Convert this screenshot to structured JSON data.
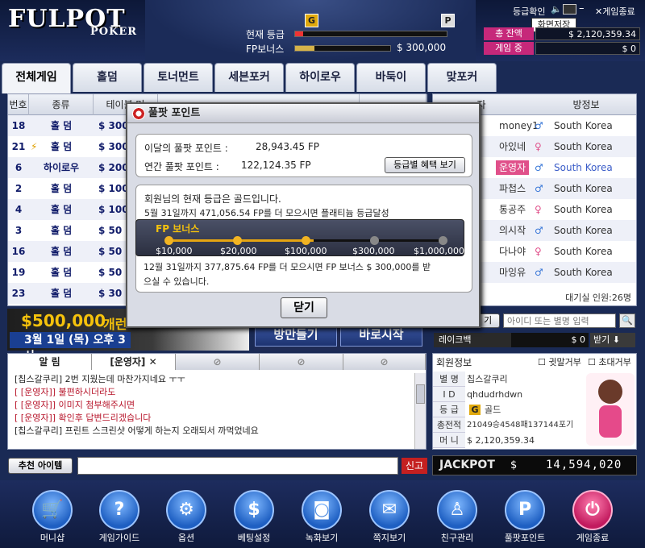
{
  "header": {
    "logo": "FULPOT",
    "logo_sub": "POKER",
    "grade_label": "현재 등급",
    "fp_bonus_label": "FP보너스",
    "fp_bonus_value": "$ 300,000",
    "badge_g": "G",
    "badge_p": "P",
    "links": {
      "grade_check": "등급확인",
      "fullscreen": "화면저장",
      "exit": "게임종료"
    },
    "tooltip": "화면저장",
    "total_balance_label": "총 잔액",
    "total_balance_value": "$ 2,120,359.34",
    "in_game_label": "게임 중",
    "in_game_value": "$ 0"
  },
  "tabs": [
    {
      "label": "전체게임",
      "active": true
    },
    {
      "label": "홀덤"
    },
    {
      "label": "토너먼트"
    },
    {
      "label": "세븐포커"
    },
    {
      "label": "하이로우"
    },
    {
      "label": "바둑이"
    },
    {
      "label": "맞포커"
    }
  ],
  "table": {
    "headers": [
      "번호",
      "종류",
      "테이블 머",
      "",
      ""
    ],
    "rows": [
      {
        "no": "18",
        "type": "홀 덤",
        "stake": "$ 300"
      },
      {
        "no": "21",
        "type": "홀 덤",
        "stake": "$ 300",
        "bolt": true
      },
      {
        "no": "6",
        "type": "하이로우",
        "stake": "$ 200"
      },
      {
        "no": "2",
        "type": "홀 덤",
        "stake": "$ 100"
      },
      {
        "no": "4",
        "type": "홀 덤",
        "stake": "$ 100"
      },
      {
        "no": "3",
        "type": "홀 덤",
        "stake": "$ 50"
      },
      {
        "no": "16",
        "type": "홀 덤",
        "stake": "$ 50"
      },
      {
        "no": "19",
        "type": "홀 덤",
        "stake": "$ 50"
      },
      {
        "no": "23",
        "type": "홀 덤",
        "stake": "$ 30"
      }
    ]
  },
  "users": {
    "headers": [
      "자",
      "방정보"
    ],
    "rows": [
      {
        "name": "money1",
        "gender": "m",
        "country": "South Korea"
      },
      {
        "name": "아있네",
        "gender": "f",
        "country": "South Korea"
      },
      {
        "name": "운영자",
        "gender": "m",
        "country": "South Korea",
        "highlight": true
      },
      {
        "name": "파첩스",
        "gender": "m",
        "country": "South Korea"
      },
      {
        "name": "통공주",
        "gender": "f",
        "country": "South Korea"
      },
      {
        "name": "의시작",
        "gender": "m",
        "country": "South Korea"
      },
      {
        "name": "다나야",
        "gender": "f",
        "country": "South Korea"
      },
      {
        "name": "마잉유",
        "gender": "m",
        "country": "South Korea"
      }
    ],
    "waiting": "대기실 인원:26명",
    "search_placeholder": "아이디 또는 별명 입력",
    "search_btn": "기",
    "rake_label": "레이크백",
    "rake_value": "$ 0",
    "rake_btn": "받기"
  },
  "modal": {
    "title": "풀팟 포인트",
    "month_label": "이달의 풀팟 포인트 :",
    "month_value": "28,943.45 FP",
    "year_label": "연간 풀팟 포인트 :",
    "year_value": "122,124.35 FP",
    "benefit_btn": "등급별 혜택 보기",
    "grade_msg": "회원님의 현재 등급은 골드입니다.",
    "platinum_msg": "5월 31일까지 471,056.54 FP를 더 모으시면 플래티늄 등급달성",
    "fp_bonus_title": "FP 보너스",
    "fp_levels": [
      "$10,000",
      "$20,000",
      "$100,000",
      "$300,000",
      "$1,000,000"
    ],
    "fp_achieved": 3,
    "bonus_msg_1": "12월 31일까지 377,875.64 FP를 더 모으시면 FP 보너스 $ 300,000를 받",
    "bonus_msg_2": "으실 수 있습니다.",
    "close_btn": "닫기"
  },
  "banner": {
    "amount": "$500,000",
    "text": "개런",
    "date": "3월 1일 (목) 오후 3시",
    "btn1": "방만들기",
    "btn2": "바로시작"
  },
  "chat": {
    "tabs": [
      "알 림",
      "[운영자]"
    ],
    "lines": [
      {
        "text": "[칩스갈쿠리] 2번 지웠는데 마찬가지네요 ㅜㅜ",
        "op": false
      },
      {
        "text": "[  [운영자]] 불편하시더라도",
        "op": true
      },
      {
        "text": "[  [운영자]] 이미지 첨부해주시면",
        "op": true
      },
      {
        "text": "[  [운영자]] 확인후 답변드리겠습니다",
        "op": true
      },
      {
        "text": "[칩스갈쿠리] 프린트 스크린샷 어떻게 하는지 오래되서 까먹었네요",
        "op": false
      }
    ],
    "recommend_btn": "추천 아이템",
    "report_btn": "신고"
  },
  "member": {
    "title": "회원정보",
    "whisper": "귓말거부",
    "invite": "초대거부",
    "rows": [
      {
        "label": "별 명",
        "value": "칩스갈쿠리"
      },
      {
        "label": "I D",
        "value": "qhdudrhdwn"
      },
      {
        "label": "등 급",
        "value": "골드"
      },
      {
        "label": "총전적",
        "value": "21049승4548패137144포기"
      },
      {
        "label": "머 니",
        "value": "$ 2,120,359.34"
      }
    ]
  },
  "jackpot": {
    "label": "JACKPOT",
    "currency": "$",
    "value": "14,594,020"
  },
  "bottom": [
    {
      "label": "머니샵",
      "icon": "cart-icon",
      "glyph": "🛒"
    },
    {
      "label": "게임가이드",
      "icon": "question-icon",
      "glyph": "?"
    },
    {
      "label": "옵션",
      "icon": "gear-icon",
      "glyph": "⚙"
    },
    {
      "label": "베팅설정",
      "icon": "chips-icon",
      "glyph": "$"
    },
    {
      "label": "녹화보기",
      "icon": "camera-icon",
      "glyph": "◙"
    },
    {
      "label": "쪽지보기",
      "icon": "mail-icon",
      "glyph": "✉"
    },
    {
      "label": "친구관리",
      "icon": "friend-icon",
      "glyph": "♙"
    },
    {
      "label": "풀팟포인트",
      "icon": "point-icon",
      "glyph": "P"
    },
    {
      "label": "게임종료",
      "icon": "power-icon",
      "glyph": "⏻"
    }
  ],
  "colors": {
    "accent_pink": "#c6287a",
    "gold": "#e0a90e",
    "navy": "#1a2a55"
  }
}
